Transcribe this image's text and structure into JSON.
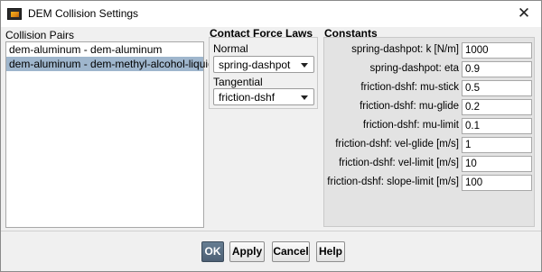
{
  "window": {
    "title": "DEM Collision Settings",
    "icon": "fluent-app-icon",
    "close_glyph": "✕"
  },
  "collision_pairs": {
    "label": "Collision Pairs",
    "items": [
      {
        "label": "dem-aluminum - dem-aluminum",
        "selected": false
      },
      {
        "label": "dem-aluminum - dem-methyl-alcohol-liquid",
        "selected": true
      }
    ]
  },
  "contact_force_laws": {
    "label": "Contact Force Laws",
    "normal": {
      "label": "Normal",
      "value": "spring-dashpot"
    },
    "tangential": {
      "label": "Tangential",
      "value": "friction-dshf"
    }
  },
  "constants": {
    "label": "Constants",
    "rows": [
      {
        "label": "spring-dashpot: k [N/m]",
        "value": "1000"
      },
      {
        "label": "spring-dashpot: eta",
        "value": "0.9"
      },
      {
        "label": "friction-dshf: mu-stick",
        "value": "0.5"
      },
      {
        "label": "friction-dshf: mu-glide",
        "value": "0.2"
      },
      {
        "label": "friction-dshf: mu-limit",
        "value": "0.1"
      },
      {
        "label": "friction-dshf: vel-glide [m/s]",
        "value": "1"
      },
      {
        "label": "friction-dshf: vel-limit [m/s]",
        "value": "10"
      },
      {
        "label": "friction-dshf: slope-limit [m/s]",
        "value": "100"
      }
    ]
  },
  "buttons": {
    "ok": "OK",
    "apply": "Apply",
    "cancel": "Cancel",
    "help": "Help"
  },
  "colors": {
    "selection": "#9fb6cd",
    "primary_button": "#5a6e82",
    "constants_panel": "#e3e3e3"
  }
}
